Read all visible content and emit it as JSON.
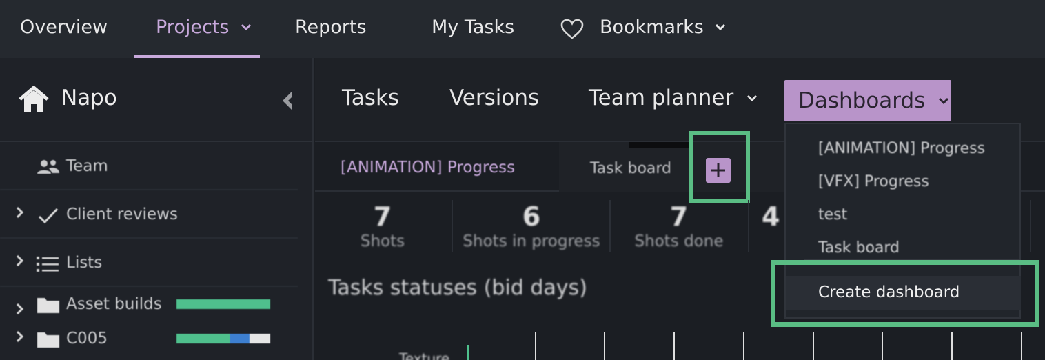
{
  "topnav": {
    "overview": "Overview",
    "projects": "Projects",
    "reports": "Reports",
    "my_tasks": "My Tasks",
    "bookmarks": "Bookmarks"
  },
  "sidebar": {
    "project_name": "Napo",
    "items": [
      {
        "label": "Team",
        "icon": "team-icon"
      },
      {
        "label": "Client reviews",
        "icon": "check-icon"
      },
      {
        "label": "Lists",
        "icon": "list-icon"
      },
      {
        "label": "Asset builds",
        "icon": "folder-icon",
        "progress": {
          "done": 1.0,
          "wip": 0.0
        }
      },
      {
        "label": "C005",
        "icon": "folder-icon",
        "progress": {
          "done": 0.57,
          "wip": 0.21
        }
      }
    ]
  },
  "subnav": {
    "tasks": "Tasks",
    "versions": "Versions",
    "team_planner": "Team planner",
    "dashboards": "Dashboards"
  },
  "dashboard_tabs": {
    "tab1": "[ANIMATION] Progress",
    "tab2": "Task board"
  },
  "stats": [
    {
      "value": "7",
      "label": "Shots"
    },
    {
      "value": "6",
      "label": "Shots in progress"
    },
    {
      "value": "7",
      "label": "Shots done"
    },
    {
      "value": "4",
      "label": ""
    }
  ],
  "section": {
    "title": "Tasks statuses (bid days)",
    "row_label": "Texture"
  },
  "dropdown": {
    "options": [
      "[ANIMATION] Progress",
      "[VFX] Progress",
      "test",
      "Task board"
    ],
    "create": "Create dashboard"
  },
  "colors": {
    "accent_purple": "#c8a9dc",
    "button_purple": "#b894c9",
    "highlight_green": "#5abd84",
    "progress_done": "#4fc08d",
    "progress_wip": "#3d7fd0"
  }
}
